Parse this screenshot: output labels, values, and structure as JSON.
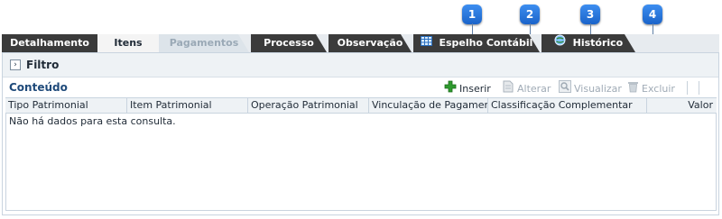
{
  "callouts": [
    "1",
    "2",
    "3",
    "4"
  ],
  "tabs": [
    {
      "label": "Detalhamento",
      "state": "normal"
    },
    {
      "label": "Itens",
      "state": "active"
    },
    {
      "label": "Pagamentos",
      "state": "disabled"
    },
    {
      "label": "Processo",
      "state": "normal"
    },
    {
      "label": "Observação",
      "state": "normal"
    },
    {
      "label": "Espelho Contábil",
      "state": "normal",
      "icon": "table-icon"
    },
    {
      "label": "Histórico",
      "state": "normal",
      "icon": "history-globe-icon"
    }
  ],
  "filter": {
    "label": "Filtro",
    "toggle_icon": "chevron-right-icon"
  },
  "content": {
    "title": "Conteúdo",
    "actions": [
      {
        "label": "Inserir",
        "icon": "plus-icon",
        "enabled": true
      },
      {
        "label": "Alterar",
        "icon": "edit-document-icon",
        "enabled": false
      },
      {
        "label": "Visualizar",
        "icon": "magnifier-icon",
        "enabled": false
      },
      {
        "label": "Excluir",
        "icon": "trash-icon",
        "enabled": false
      }
    ]
  },
  "table": {
    "columns": [
      "Tipo Patrimonial",
      "Item Patrimonial",
      "Operação Patrimonial",
      "Vinculação de Pagamento",
      "Classificação Complementar",
      "Valor"
    ],
    "empty_message": "Não há dados para esta consulta."
  },
  "colors": {
    "accent": "#1f63c9",
    "tab_dark": "#3b3b3b",
    "plus_green": "#2e9a2e"
  }
}
